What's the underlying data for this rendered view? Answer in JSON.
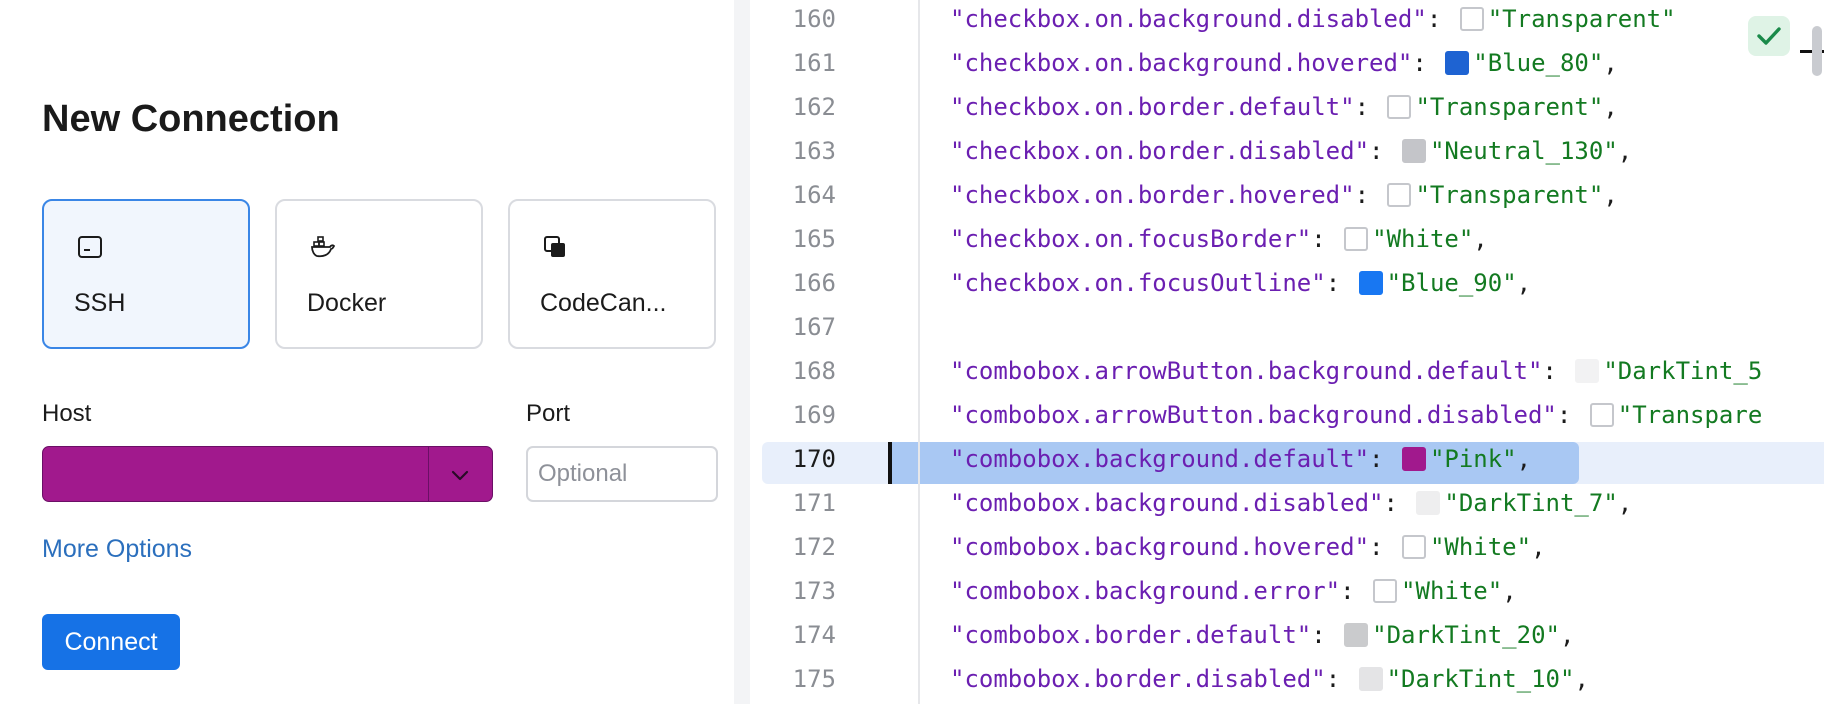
{
  "connection": {
    "title": "New Connection",
    "options": [
      {
        "label": "SSH",
        "icon": "terminal-icon"
      },
      {
        "label": "Docker",
        "icon": "docker-whale-icon"
      },
      {
        "label": "CodeCan...",
        "icon": "codecanvas-icon"
      }
    ],
    "host_label": "Host",
    "host_value": "",
    "host_color": "#a1198d",
    "port_label": "Port",
    "port_placeholder": "Optional",
    "more_options": "More Options",
    "connect": "Connect"
  },
  "editor": {
    "current_line": 170,
    "lines": [
      {
        "n": "160",
        "key": "\"checkbox.on.background.disabled\"",
        "swatch": "#ffffff",
        "value": "\"Transparent\"",
        "comma": ""
      },
      {
        "n": "161",
        "key": "\"checkbox.on.background.hovered\"",
        "swatch": "#1e63d2",
        "value": "\"Blue_80\"",
        "comma": ","
      },
      {
        "n": "162",
        "key": "\"checkbox.on.border.default\"",
        "swatch": "#ffffff",
        "value": "\"Transparent\"",
        "comma": ","
      },
      {
        "n": "163",
        "key": "\"checkbox.on.border.disabled\"",
        "swatch": "#c4c5c9",
        "value": "\"Neutral_130\"",
        "comma": ","
      },
      {
        "n": "164",
        "key": "\"checkbox.on.border.hovered\"",
        "swatch": "#ffffff",
        "value": "\"Transparent\"",
        "comma": ","
      },
      {
        "n": "165",
        "key": "\"checkbox.on.focusBorder\"",
        "swatch": "#ffffff",
        "value": "\"White\"",
        "comma": ","
      },
      {
        "n": "166",
        "key": "\"checkbox.on.focusOutline\"",
        "swatch": "#1877f2",
        "value": "\"Blue_90\"",
        "comma": ","
      },
      {
        "n": "167",
        "key": "",
        "swatch": "",
        "value": "",
        "comma": ""
      },
      {
        "n": "168",
        "key": "\"combobox.arrowButton.background.default\"",
        "swatch": "#f2f2f3",
        "value": "\"DarkTint_5",
        "comma": ""
      },
      {
        "n": "169",
        "key": "\"combobox.arrowButton.background.disabled\"",
        "swatch": "#ffffff",
        "value": "\"Transpare",
        "comma": ""
      },
      {
        "n": "170",
        "key": "\"combobox.background.default\"",
        "swatch": "#a1198d",
        "value": "\"Pink\"",
        "comma": ","
      },
      {
        "n": "171",
        "key": "\"combobox.background.disabled\"",
        "swatch": "#eeeeef",
        "value": "\"DarkTint_7\"",
        "comma": ","
      },
      {
        "n": "172",
        "key": "\"combobox.background.hovered\"",
        "swatch": "#ffffff",
        "value": "\"White\"",
        "comma": ","
      },
      {
        "n": "173",
        "key": "\"combobox.background.error\"",
        "swatch": "#ffffff",
        "value": "\"White\"",
        "comma": ","
      },
      {
        "n": "174",
        "key": "\"combobox.border.default\"",
        "swatch": "#cacbcd",
        "value": "\"DarkTint_20\"",
        "comma": ","
      },
      {
        "n": "175",
        "key": "\"combobox.border.disabled\"",
        "swatch": "#e4e4e6",
        "value": "\"DarkTint_10\"",
        "comma": ","
      }
    ]
  },
  "colors": {
    "accent": "#1672e6",
    "link": "#2b6fbd",
    "key_purple": "#6b1fb1",
    "string_green": "#137a21",
    "selection": "#a9c8f3"
  }
}
